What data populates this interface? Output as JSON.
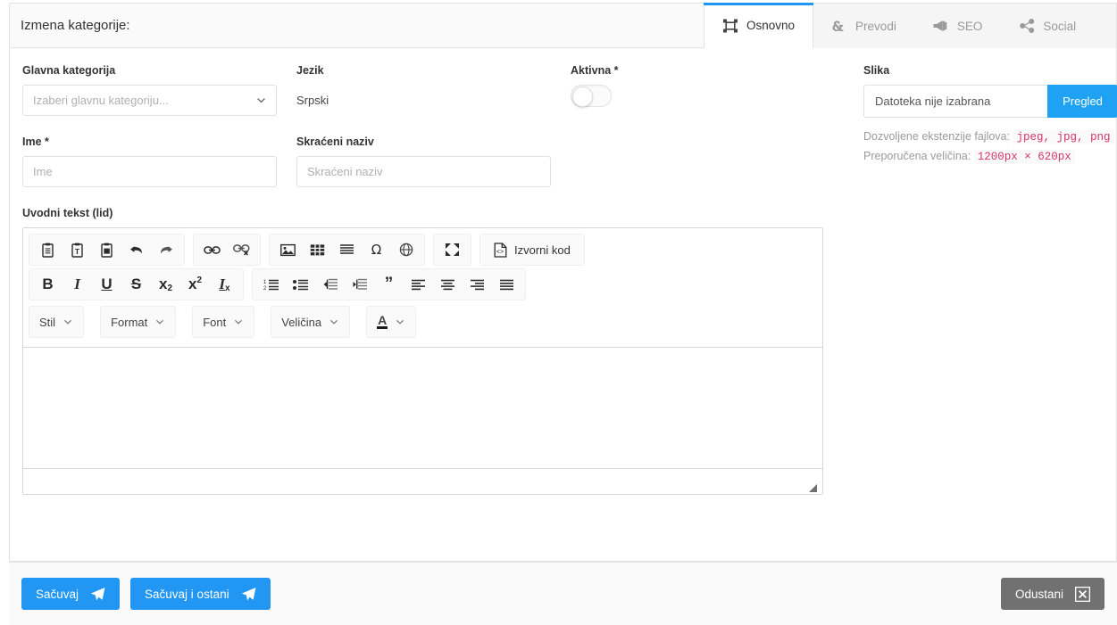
{
  "header": {
    "title": "Izmena kategorije:",
    "tabs": [
      {
        "label": "Osnovno",
        "icon": "frame-icon",
        "active": true
      },
      {
        "label": "Prevodi",
        "icon": "translate-icon",
        "active": false
      },
      {
        "label": "SEO",
        "icon": "megaphone-icon",
        "active": false
      },
      {
        "label": "Social",
        "icon": "share-icon",
        "active": false
      }
    ]
  },
  "form": {
    "parent_category": {
      "label": "Glavna kategorija",
      "placeholder": "Izaberi glavnu kategoriju..."
    },
    "language": {
      "label": "Jezik",
      "value": "Srpski"
    },
    "active": {
      "label": "Aktivna *",
      "state": "off"
    },
    "name": {
      "label": "Ime *",
      "placeholder": "Ime",
      "value": ""
    },
    "short_name": {
      "label": "Skraćeni naziv",
      "placeholder": "Skraćeni naziv",
      "value": ""
    },
    "lead_text": {
      "label": "Uvodni tekst (lid)",
      "content": ""
    }
  },
  "editor": {
    "source_button": "Izvorni kod",
    "dropdowns": [
      {
        "label": "Stil"
      },
      {
        "label": "Format"
      },
      {
        "label": "Font"
      },
      {
        "label": "Veličina"
      }
    ],
    "buttons_row1": [
      "paste-icon",
      "paste-as-text-icon",
      "paste-from-word-icon",
      "undo-icon",
      "redo-icon",
      "link-icon",
      "unlink-icon",
      "image-icon",
      "table-icon",
      "horizontal-rule-icon",
      "special-character-icon",
      "iframe-icon",
      "maximize-icon",
      "source-code-icon"
    ],
    "buttons_row2": [
      "bold-icon",
      "italic-icon",
      "underline-icon",
      "strikethrough-icon",
      "subscript-icon",
      "superscript-icon",
      "remove-format-icon",
      "numbered-list-icon",
      "bulleted-list-icon",
      "outdent-icon",
      "indent-icon",
      "blockquote-icon",
      "align-left-icon",
      "align-center-icon",
      "align-right-icon",
      "justify-icon"
    ],
    "text_color_icon": "text-color-icon",
    "bold_label": "B",
    "italic_label": "I",
    "underline_label": "U",
    "strike_label": "S",
    "subscript_label": "x",
    "subscript_sub": "2",
    "superscript_label": "x",
    "superscript_sup": "2",
    "removeformat_label": "I",
    "removeformat_sub": "x",
    "color_letter": "A"
  },
  "image_panel": {
    "label": "Slika",
    "file_name": "Datoteka nije izabrana",
    "browse_button": "Pregled",
    "extensions_label": "Dozvoljene ekstenzije fajlova:",
    "extensions_value": "jpeg, jpg, png",
    "size_label": "Preporučena veličina:",
    "size_value": "1200px × 620px"
  },
  "footer": {
    "save": "Sačuvaj",
    "save_stay": "Sačuvaj i ostani",
    "cancel": "Odustani"
  },
  "colors": {
    "accent": "#2196f3",
    "file_button": "#1fa2f3",
    "cancel": "#717171",
    "code_text": "#d6336c"
  }
}
